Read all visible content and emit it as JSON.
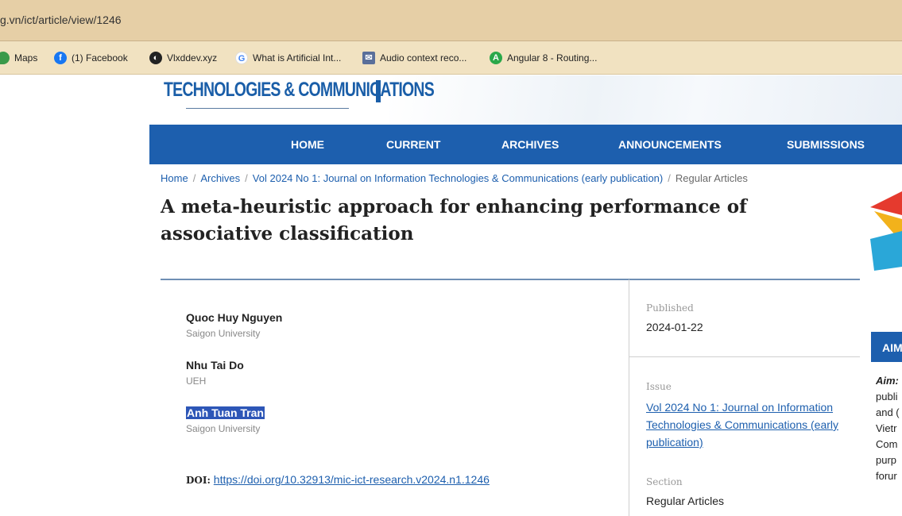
{
  "browser": {
    "url": "g.vn/ict/article/view/1246",
    "bookmarks": [
      {
        "label": "Maps",
        "icon": "maps-pin-icon"
      },
      {
        "label": "(1) Facebook",
        "icon": "facebook-icon"
      },
      {
        "label": "Vlxddev.xyz",
        "icon": "site-icon"
      },
      {
        "label": "What is Artificial Int...",
        "icon": "google-icon"
      },
      {
        "label": "Audio context reco...",
        "icon": "mail-icon"
      },
      {
        "label": "Angular 8 - Routing...",
        "icon": "angular-icon"
      }
    ]
  },
  "header": {
    "logo_text": "TECHNOLOGIES & COMMUNICATIONS"
  },
  "nav": {
    "items": [
      "HOME",
      "CURRENT",
      "ARCHIVES",
      "ANNOUNCEMENTS",
      "SUBMISSIONS"
    ]
  },
  "breadcrumb": {
    "items": [
      "Home",
      "Archives",
      "Vol 2024 No 1: Journal on Information Technologies & Communications (early publication)",
      "Regular Articles"
    ]
  },
  "article": {
    "title": "A meta-heuristic approach for enhancing performance of associative classification",
    "authors": [
      {
        "name": "Quoc Huy Nguyen",
        "affiliation": "Saigon University"
      },
      {
        "name": "Nhu Tai Do",
        "affiliation": "UEH"
      },
      {
        "name": "Anh Tuan Tran",
        "affiliation": "Saigon University"
      }
    ],
    "doi_label": "DOI:",
    "doi_url": "https://doi.org/10.32913/mic-ict-research.v2024.n1.1246"
  },
  "details": {
    "published_label": "Published",
    "published_value": "2024-01-22",
    "issue_label": "Issue",
    "issue_value": "Vol 2024 No 1: Journal on Information Technologies & Communications (early publication)",
    "section_label": "Section",
    "section_value": "Regular Articles"
  },
  "sidebar": {
    "aim_header": "AIM",
    "aim_lines": [
      "Aim:",
      "publi",
      "and (",
      "Vietr",
      "Com",
      "purp",
      "forur"
    ]
  },
  "colors": {
    "nav_blue": "#1d5fae",
    "browser_bar": "#e6cfa6",
    "selection": "#2d56b7"
  }
}
